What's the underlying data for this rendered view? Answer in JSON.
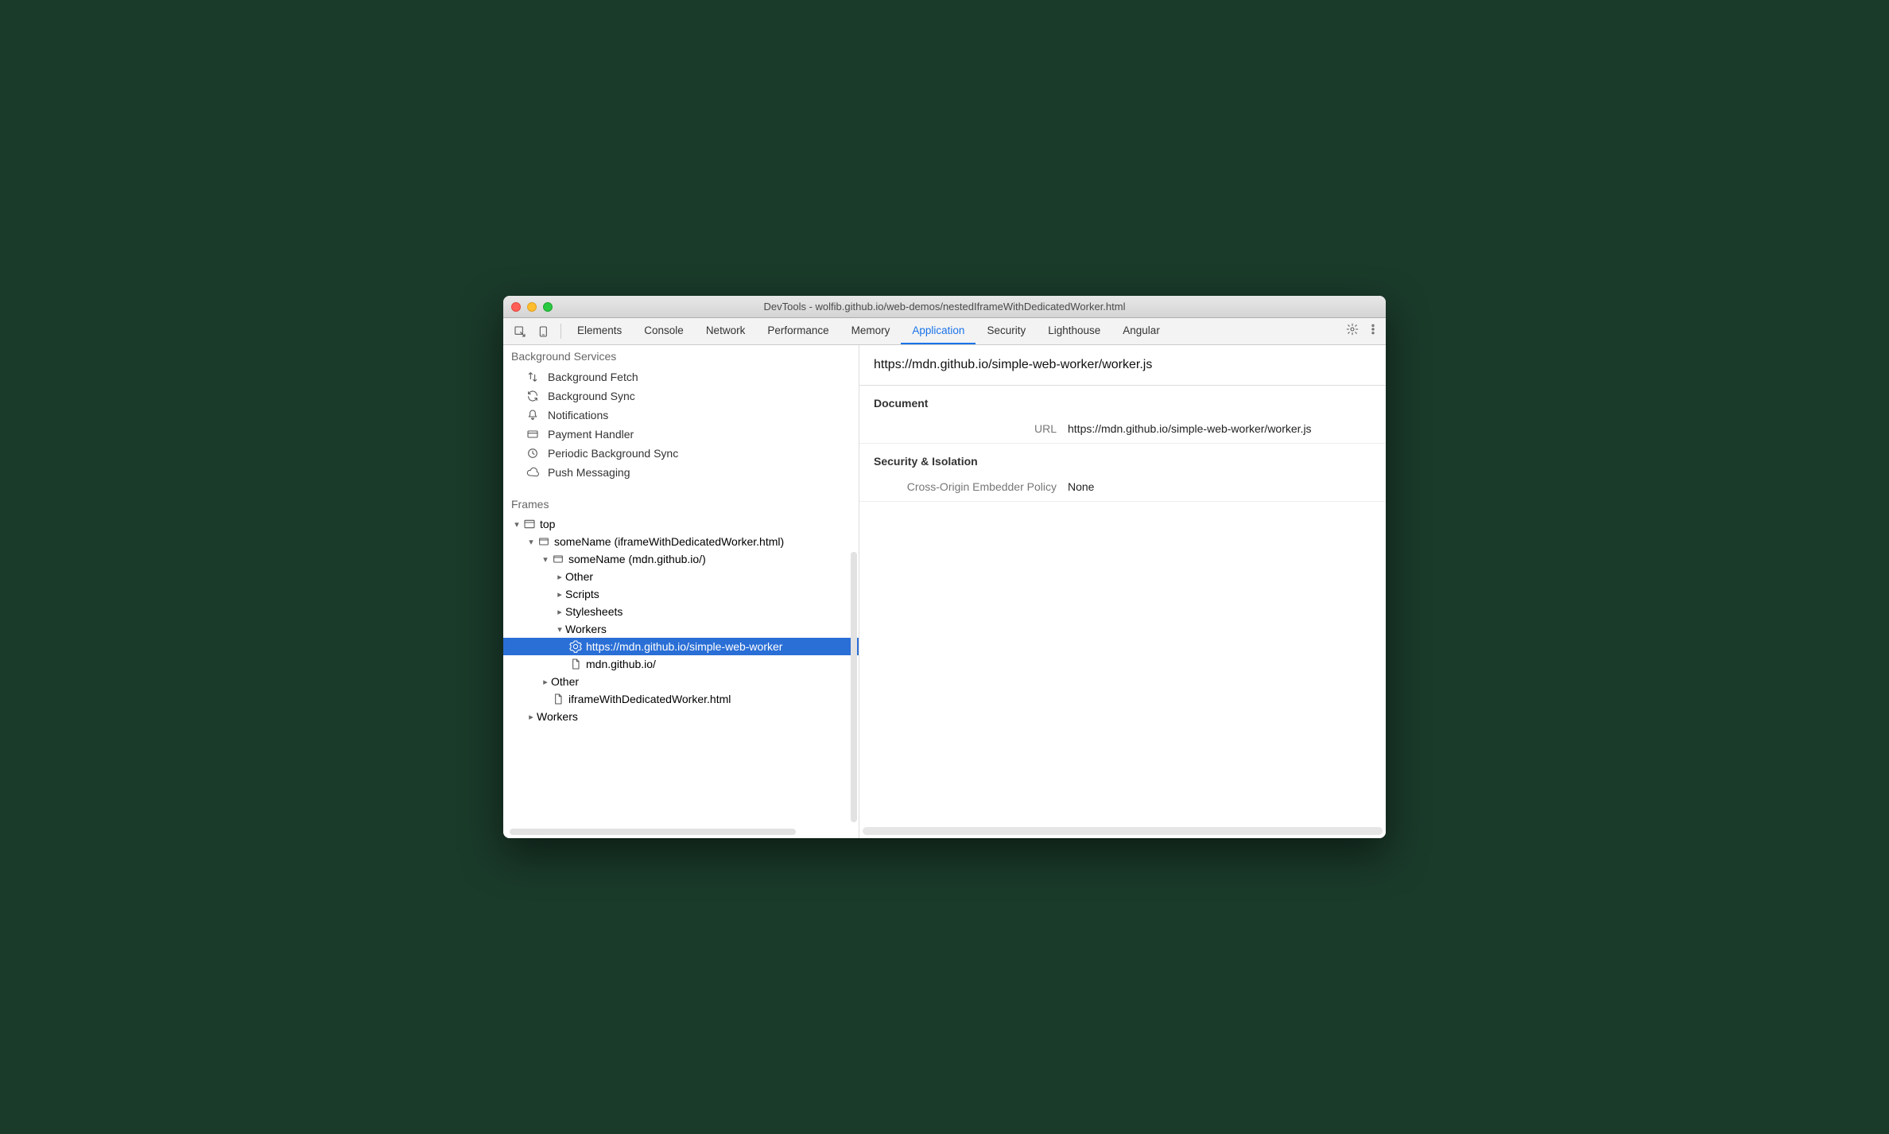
{
  "window": {
    "title": "DevTools - wolfib.github.io/web-demos/nestedIframeWithDedicatedWorker.html"
  },
  "tabs": {
    "items": [
      "Elements",
      "Console",
      "Network",
      "Performance",
      "Memory",
      "Application",
      "Security",
      "Lighthouse",
      "Angular"
    ],
    "active": "Application"
  },
  "sidebar": {
    "bgServices": {
      "heading": "Background Services",
      "items": [
        {
          "icon": "updown",
          "label": "Background Fetch"
        },
        {
          "icon": "sync",
          "label": "Background Sync"
        },
        {
          "icon": "bell",
          "label": "Notifications"
        },
        {
          "icon": "card",
          "label": "Payment Handler"
        },
        {
          "icon": "clock",
          "label": "Periodic Background Sync"
        },
        {
          "icon": "cloud",
          "label": "Push Messaging"
        }
      ]
    },
    "frames": {
      "heading": "Frames",
      "tree": {
        "top": "top",
        "f1": "someName (iframeWithDedicatedWorker.html)",
        "f2": "someName (mdn.github.io/)",
        "other1": "Other",
        "scripts": "Scripts",
        "stylesheets": "Stylesheets",
        "workers": "Workers",
        "workerUrl": "https://mdn.github.io/simple-web-worker",
        "mdnFile": "mdn.github.io/",
        "other2": "Other",
        "iframeFile": "iframeWithDedicatedWorker.html",
        "workersBottom": "Workers"
      }
    }
  },
  "main": {
    "title": "https://mdn.github.io/simple-web-worker/worker.js",
    "documentHeading": "Document",
    "urlLabel": "URL",
    "urlValue": "https://mdn.github.io/simple-web-worker/worker.js",
    "securityHeading": "Security & Isolation",
    "coepLabel": "Cross-Origin Embedder Policy",
    "coepValue": "None"
  }
}
